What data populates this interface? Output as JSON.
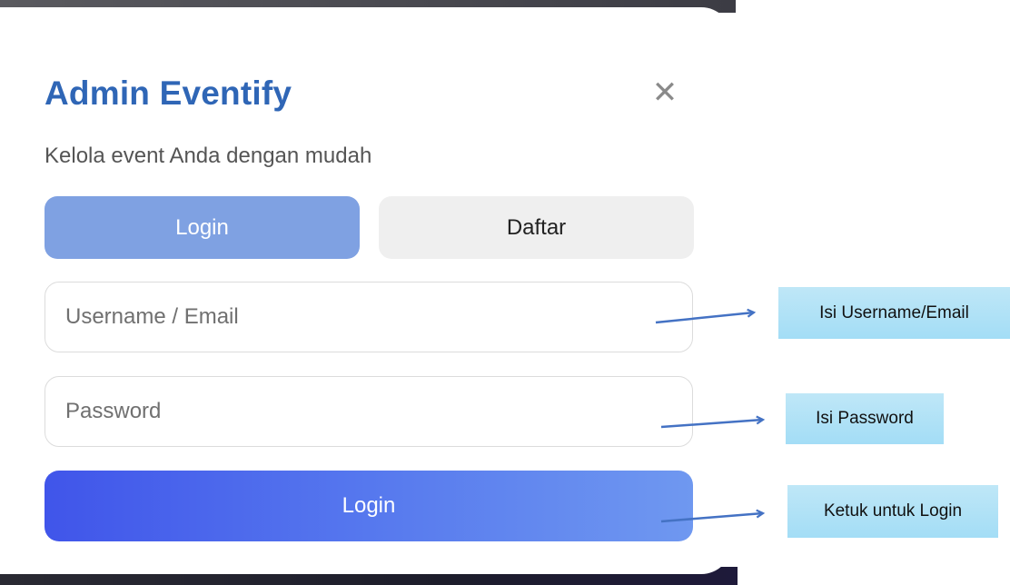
{
  "modal": {
    "title": "Admin Eventify",
    "close_symbol": "✕",
    "subtitle": "Kelola event Anda dengan mudah",
    "tabs": [
      {
        "label": "Login",
        "active": true
      },
      {
        "label": "Daftar",
        "active": false
      }
    ],
    "username_field": {
      "placeholder": "Username / Email",
      "value": ""
    },
    "password_field": {
      "placeholder": "Password",
      "value": ""
    },
    "submit_label": "Login"
  },
  "annotations": [
    {
      "text": "Isi Username/Email"
    },
    {
      "text": "Isi Password"
    },
    {
      "text": "Ketuk untuk Login"
    }
  ],
  "colors": {
    "title": "#2f66b6",
    "active_tab": "#7fa1e2",
    "inactive_tab": "#efefef",
    "button_gradient_start": "#4055ea",
    "button_gradient_end": "#6f98f0",
    "callout": "#a3ddf6",
    "arrow": "#4472c4"
  },
  "icons": {
    "close": "close-icon"
  }
}
